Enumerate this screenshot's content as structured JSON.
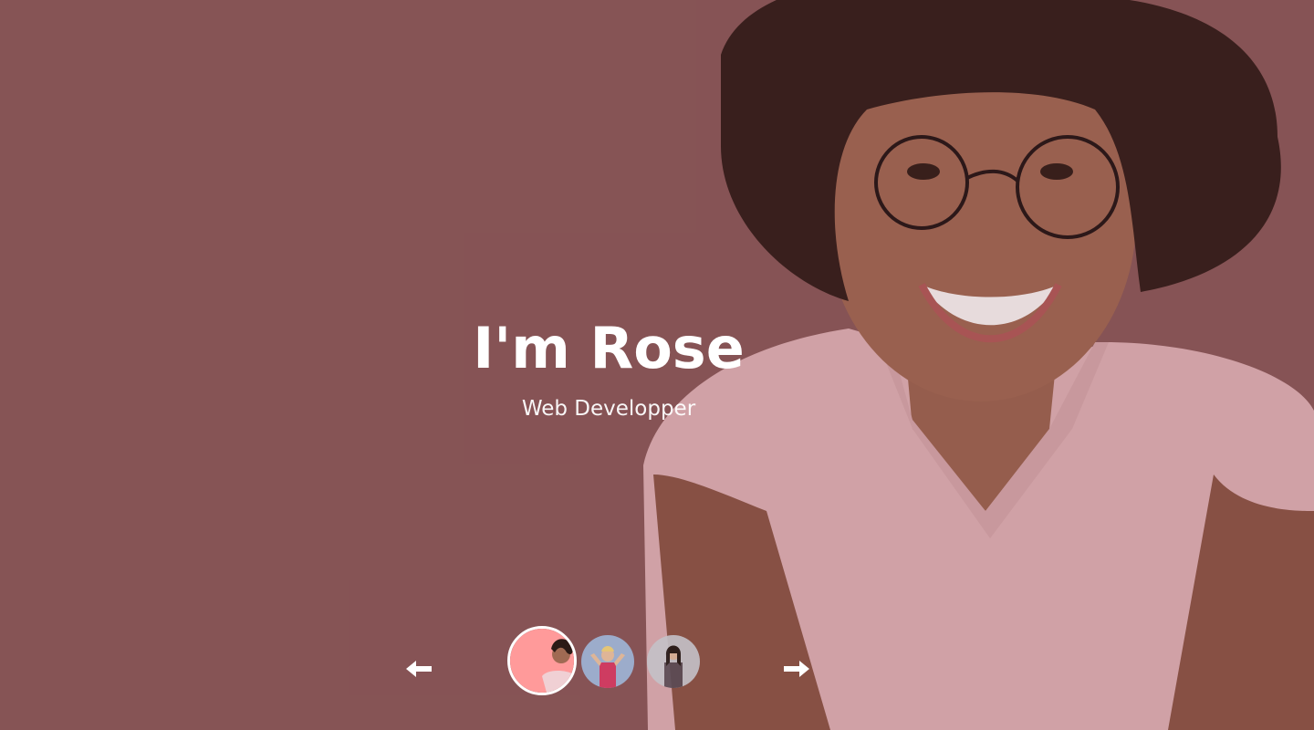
{
  "slider": {
    "title": "I'm Rose",
    "subtitle": "Web Developper",
    "colors": {
      "background": "#895a5b",
      "text": "#ffffff",
      "shirt": "#e7bfc3",
      "skin": "#8f5c49"
    },
    "controls": {
      "prev_icon": "arrow-left-icon",
      "next_icon": "arrow-right-icon"
    },
    "thumbnails": [
      {
        "name": "rose-thumbnail",
        "active": true
      },
      {
        "name": "second-person-thumbnail",
        "active": false
      },
      {
        "name": "third-person-thumbnail",
        "active": false
      }
    ]
  }
}
